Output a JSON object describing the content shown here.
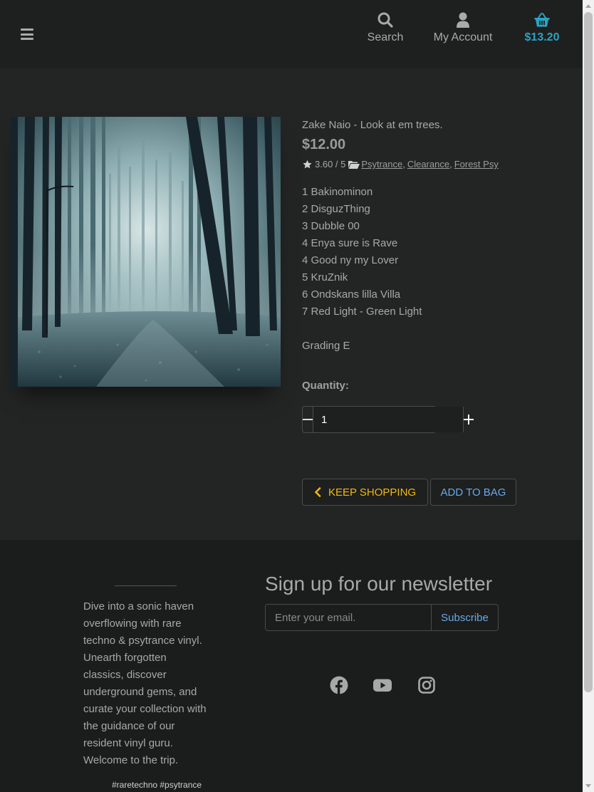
{
  "header": {
    "search_label": "Search",
    "account_label": "My Account",
    "cart_total": "$13.20",
    "accent_color": "#2aa3c4"
  },
  "product": {
    "title": "Zake Naio - Look at em trees.",
    "price": "$12.00",
    "rating": "3.60 / 5",
    "categories": [
      "Psytrance",
      "Clearance",
      "Forest Psy"
    ],
    "category_separators": [
      ",",
      ","
    ],
    "tracks": [
      "1 Bakinominon",
      "2 DisguzThing",
      "3 Dubble 00",
      "4 Enya sure is Rave",
      "4 Good ny my Lover",
      "5 KruZnik",
      "6 Ondskans lilla Villa",
      "7 Red Light - Green Light"
    ],
    "grading": "Grading E",
    "quantity_label": "Quantity:",
    "quantity_value": "1",
    "keep_shopping_label": "KEEP SHOPPING",
    "add_to_bag_label": "ADD TO BAG"
  },
  "footer": {
    "about": "Dive into a sonic haven overflowing with rare techno & psytrance vinyl. Unearth forgotten classics, discover underground gems, and curate your collection with the guidance of our resident vinyl guru. Welcome to the trip.",
    "tags": "#raretechno #psytrance",
    "newsletter_title": "Sign up for our newsletter",
    "email_placeholder": "Enter your email.",
    "subscribe_label": "Subscribe",
    "social_icons": [
      "facebook-icon",
      "youtube-icon",
      "instagram-icon"
    ]
  },
  "colors": {
    "keep_shopping": "#f0b90b",
    "add_to_bag": "#6aa9e8"
  }
}
